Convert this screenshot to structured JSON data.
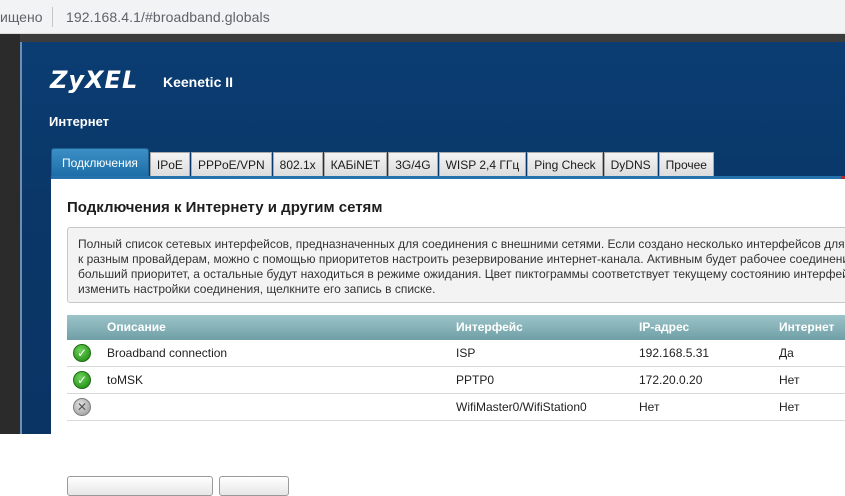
{
  "browser": {
    "security_text": "ищено",
    "url": "192.168.4.1/#broadband.globals"
  },
  "header": {
    "logo": "ZyXEL",
    "model": "Keenetic II",
    "section": "Интернет"
  },
  "tabs": [
    {
      "label": "Подключения",
      "active": true
    },
    {
      "label": "IPoE"
    },
    {
      "label": "PPPoE/VPN"
    },
    {
      "label": "802.1x"
    },
    {
      "label": "КАБiNET"
    },
    {
      "label": "3G/4G"
    },
    {
      "label": "WISP 2,4 ГГц"
    },
    {
      "label": "Ping Check"
    },
    {
      "label": "DyDNS"
    },
    {
      "label": "Прочее"
    }
  ],
  "main": {
    "title": "Подключения к Интернету и другим сетям",
    "info_lines": [
      "Полный список сетевых интерфейсов, предназначенных для соединения с внешними сетями. Если создано несколько интерфейсов для",
      "к разным провайдерам, можно с помощью приоритетов настроить резервирование интернет-канала. Активным будет рабочее соединени",
      "больший приоритет, а остальные будут находиться в режиме ожидания. Цвет пиктограммы соответствует текущему состоянию интерфей",
      "изменить настройки соединения, щелкните его запись в списке."
    ]
  },
  "table": {
    "headers": {
      "description": "Описание",
      "interface": "Интерфейс",
      "ip": "IP-адрес",
      "internet": "Интернет"
    },
    "rows": [
      {
        "status": "ok",
        "description": "Broadband connection",
        "interface": "ISP",
        "ip": "192.168.5.31",
        "internet": "Да"
      },
      {
        "status": "ok",
        "description": "toMSK",
        "interface": "PPTP0",
        "ip": "172.20.0.20",
        "internet": "Нет"
      },
      {
        "status": "off",
        "description": "",
        "interface": "WifiMaster0/WifiStation0",
        "ip": "Нет",
        "internet": "Нет"
      }
    ]
  },
  "colors": {
    "header_bg": "#0b3d73",
    "tab_active": "#2a7fb8",
    "table_header": "#7fabb1",
    "status_ok": "#2f9a22",
    "status_off": "#a8a8a8"
  },
  "icons": {
    "status_ok": "check-circle-icon",
    "status_off": "x-circle-icon"
  }
}
